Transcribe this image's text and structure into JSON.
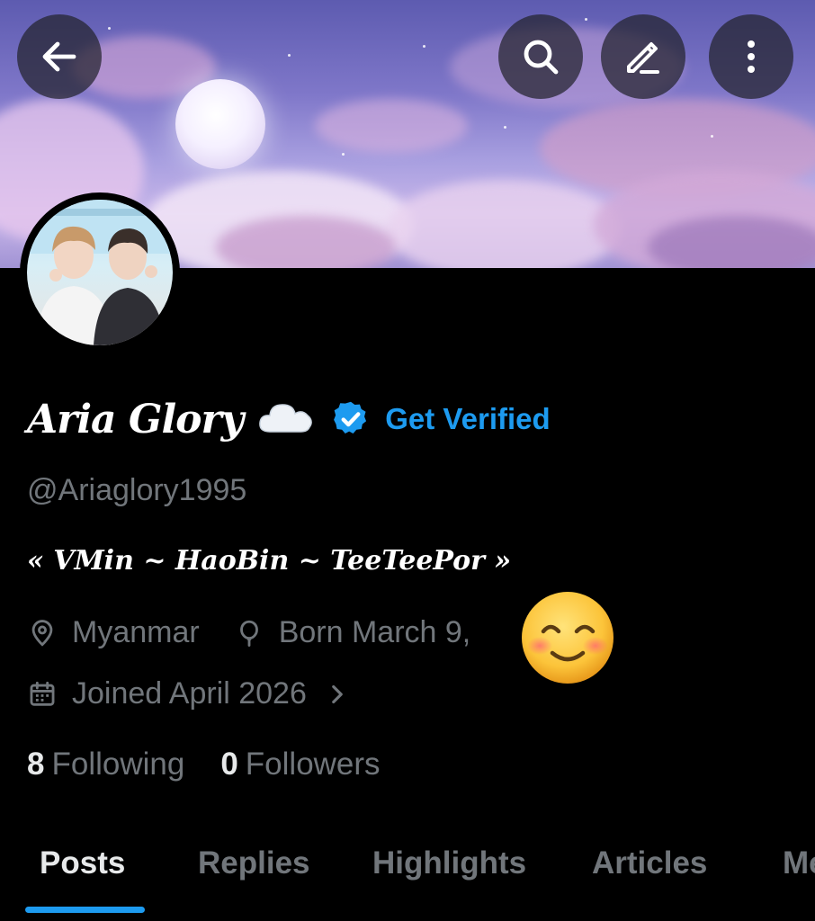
{
  "header": {
    "back_icon": "arrow-left-icon",
    "search_icon": "search-icon",
    "edit_icon": "pencil-icon",
    "more_icon": "more-vertical-icon"
  },
  "profile": {
    "display_name": "Aria Glory",
    "name_emoji": "cloud",
    "verified_badge_icon": "verified-badge-icon",
    "get_verified_label": "Get Verified",
    "handle": "@Ariaglory1995",
    "bio": "« VMin ~ HaoBin ~ TeeTeePor »",
    "location": "Myanmar",
    "birthday": "Born March 9,",
    "joined": "Joined April 2026",
    "following_count": "8",
    "following_label": "Following",
    "followers_count": "0",
    "followers_label": "Followers"
  },
  "tabs": [
    {
      "label": "Posts",
      "active": true
    },
    {
      "label": "Replies",
      "active": false
    },
    {
      "label": "Highlights",
      "active": false
    },
    {
      "label": "Articles",
      "active": false
    },
    {
      "label": "Media",
      "active": false
    }
  ],
  "colors": {
    "accent": "#1d9bf0",
    "background": "#000000",
    "secondary_text": "#71767b",
    "primary_text": "#e7e9ea"
  }
}
